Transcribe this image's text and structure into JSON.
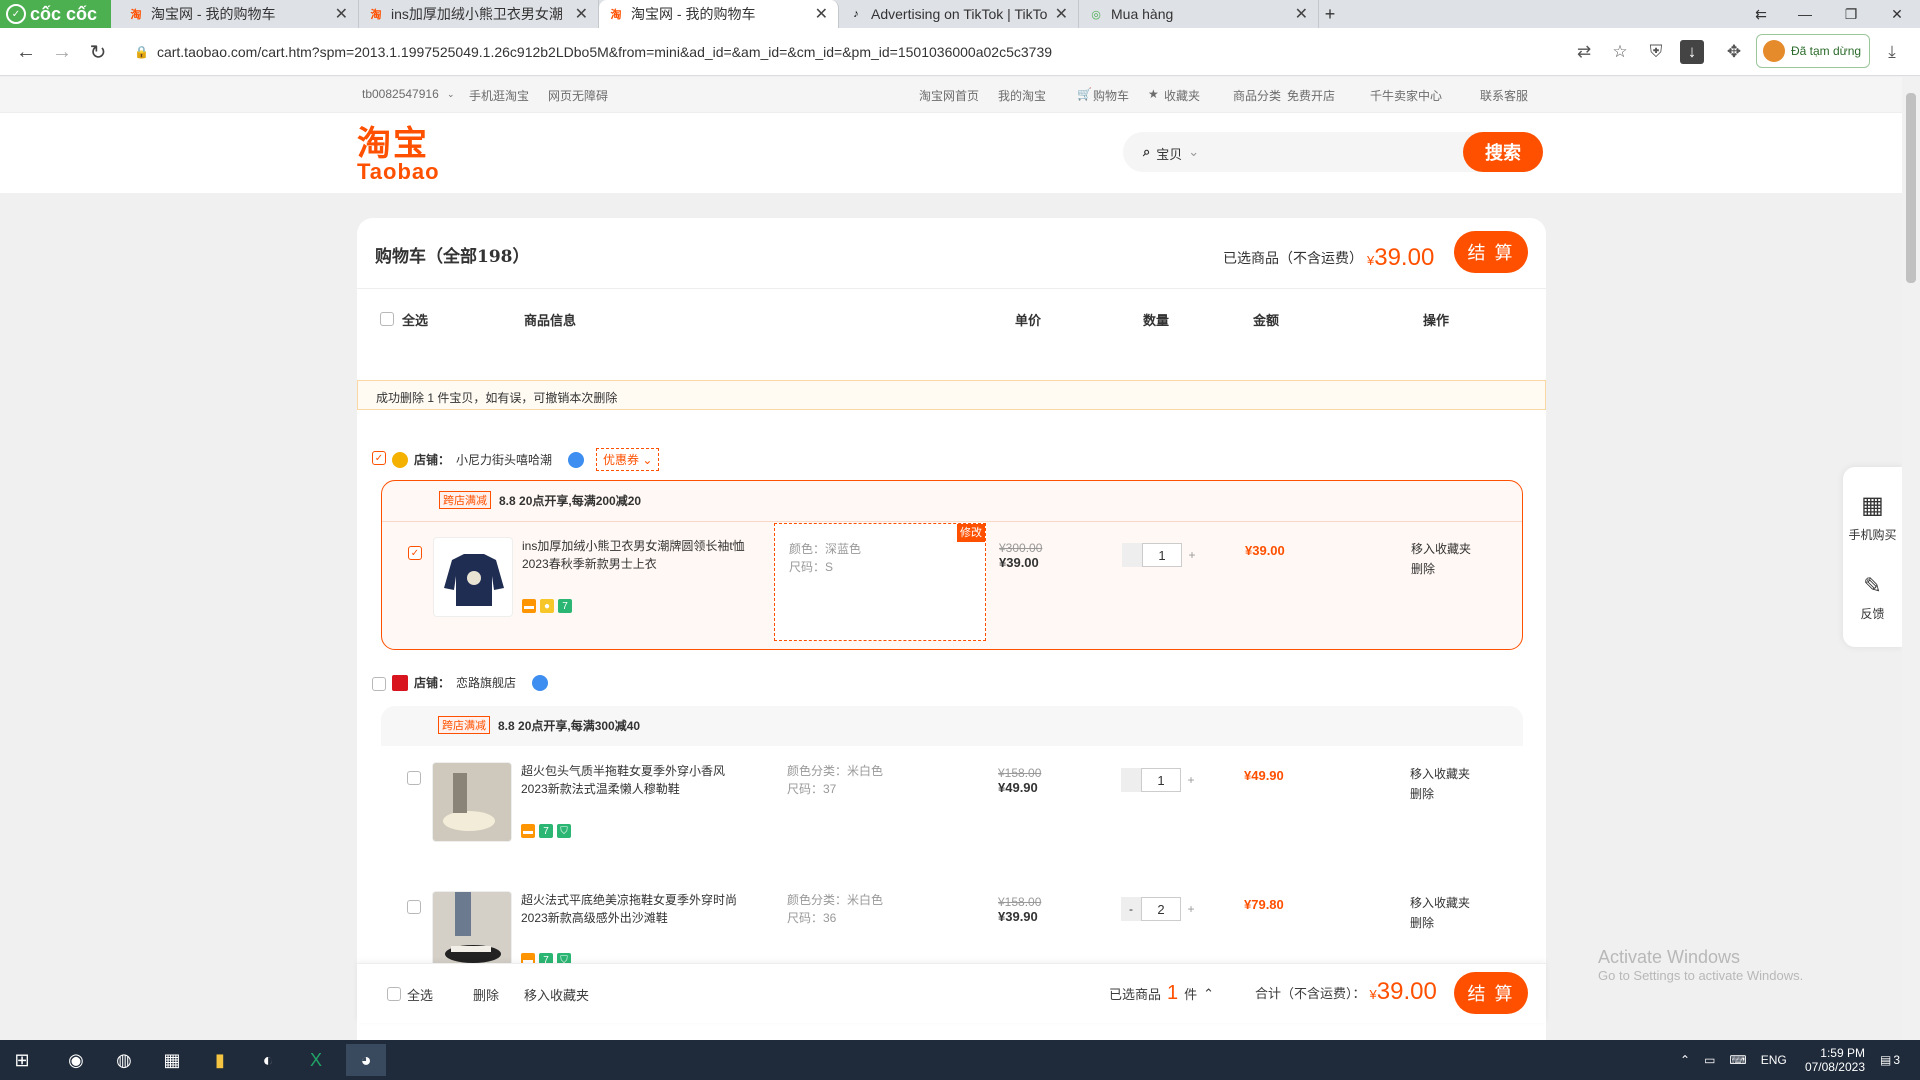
{
  "browser": {
    "brand": "cốc cốc",
    "tabs": [
      {
        "title": "淘宝网 - 我的购物车",
        "active": false
      },
      {
        "title": "ins加厚加绒小熊卫衣男女潮",
        "active": false
      },
      {
        "title": "淘宝网 - 我的购物车",
        "active": true
      },
      {
        "title": "Advertising on TikTok | TikTo",
        "active": false
      },
      {
        "title": "Mua hàng",
        "active": false
      }
    ],
    "new_tab": "+",
    "url": "cart.taobao.com/cart.htm?spm=2013.1.1997525049.1.26c912b2LDbo5M&from=mini&ad_id=&am_id=&cm_id=&pm_id=1501036000a02c5c3739",
    "pause_label": "Đã tạm dừng"
  },
  "site_top": {
    "user": "tb0082547916",
    "mobile": "手机逛淘宝",
    "accessible": "网页无障碍",
    "home": "淘宝网首页",
    "my_taobao": "我的淘宝",
    "cart": "购物车",
    "favorites": "收藏夹",
    "categories": "商品分类",
    "open_shop": "免费开店",
    "seller": "千牛卖家中心",
    "service": "联系客服"
  },
  "header": {
    "logo_cn": "淘宝",
    "logo_en": "Taobao",
    "search_type": "宝贝",
    "search_btn": "搜索"
  },
  "cart": {
    "title": "购物车（全部198）",
    "selected_label": "已选商品（不含运费）",
    "currency": "¥",
    "selected_total": "39.00",
    "checkout": "结 算",
    "columns": {
      "select_all": "全选",
      "info": "商品信息",
      "unit_price": "单价",
      "qty": "数量",
      "amount": "金额",
      "ops": "操作"
    },
    "notice": "成功删除 1 件宝贝，如有误，可撤销本次删除",
    "shops": [
      {
        "name_label": "店铺：",
        "name": "小尼力街头嘻哈潮",
        "coupon": "优惠券",
        "promo_tag": "跨店满减",
        "promo": "8.8 20点开享,每满200减20",
        "items": [
          {
            "title": "ins加厚加绒小熊卫衣男女潮牌圆领长袖t恤2023春秋季新款男士上衣",
            "sku1": "颜色：深蓝色",
            "sku2": "尺码：S",
            "edit": "修改",
            "old": "¥300.00",
            "price": "¥39.00",
            "qty": "1",
            "amount": "¥39.00",
            "fav": "移入收藏夹",
            "del": "删除",
            "checked": true
          }
        ]
      },
      {
        "name_label": "店铺：",
        "name": "恋路旗舰店",
        "promo_tag": "跨店满减",
        "promo": "8.8 20点开享,每满300减40",
        "items": [
          {
            "title": "超火包头气质半拖鞋女夏季外穿小香风2023新款法式温柔懒人穆勒鞋",
            "sku1": "颜色分类：米白色",
            "sku2": "尺码：37",
            "old": "¥158.00",
            "price": "¥49.90",
            "qty": "1",
            "amount": "¥49.90",
            "fav": "移入收藏夹",
            "del": "删除",
            "checked": false
          },
          {
            "title": "超火法式平底绝美凉拖鞋女夏季外穿时尚2023新款高级感外出沙滩鞋",
            "sku1": "颜色分类：米白色",
            "sku2": "尺码：36",
            "old": "¥158.00",
            "price": "¥39.90",
            "qty": "2",
            "amount": "¥79.80",
            "fav": "移入收藏夹",
            "del": "删除",
            "checked": false
          }
        ]
      }
    ]
  },
  "footer": {
    "select_all": "全选",
    "delete": "删除",
    "move_fav": "移入收藏夹",
    "selected_prefix": "已选商品",
    "selected_count": "1",
    "selected_unit": "件",
    "total_label": "合计（不含运费）：",
    "total": "39.00",
    "checkout": "结 算"
  },
  "side": {
    "mobile": "手机购买",
    "feedback": "反馈"
  },
  "watermark": {
    "line1": "Activate Windows",
    "line2": "Go to Settings to activate Windows."
  },
  "taskbar": {
    "lang": "ENG",
    "time": "1:59 PM",
    "date": "07/08/2023",
    "notif": "3"
  },
  "colors": {
    "accent": "#ff5000",
    "brand_green": "#4caf50"
  }
}
